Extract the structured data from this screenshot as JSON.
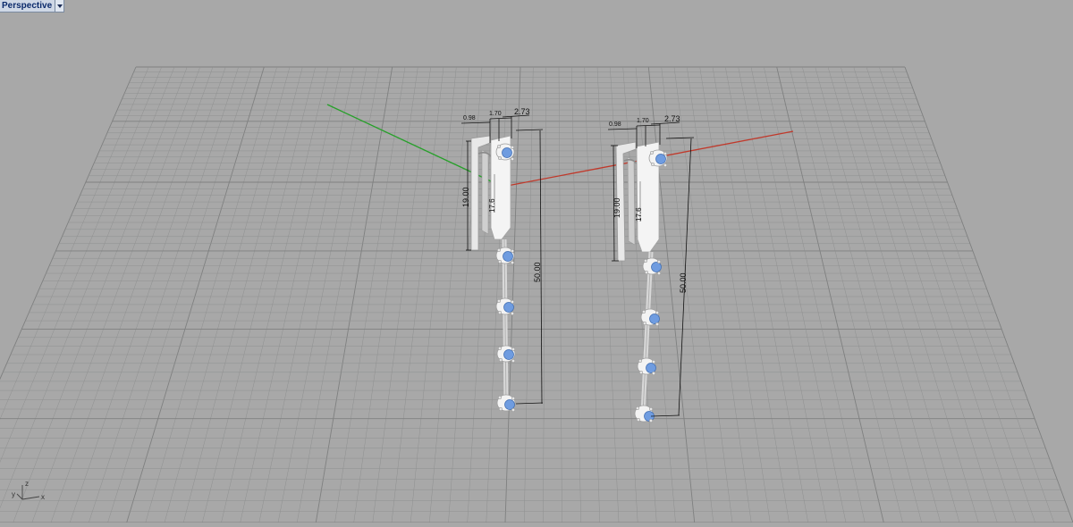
{
  "viewport": {
    "title": "Perspective",
    "background": "#a8a8a8",
    "grid_color": "#8f9090",
    "x_axis_color": "#c0392b",
    "y_axis_color": "#27a02a"
  },
  "axis_widget": {
    "z_label": "z",
    "y_label": "y",
    "x_label": "x"
  },
  "models": [
    {
      "dims": {
        "top_left": "0.98",
        "top_mid": "1.70",
        "top_right": "2.73",
        "hook_height": "19.00",
        "inner_length": "17.6",
        "total_length": "50.00"
      }
    },
    {
      "dims": {
        "top_left": "0.98",
        "top_mid": "1.70",
        "top_right": "2.73",
        "hook_height": "19.00",
        "inner_length": "17.6",
        "total_length": "50.00"
      }
    }
  ]
}
